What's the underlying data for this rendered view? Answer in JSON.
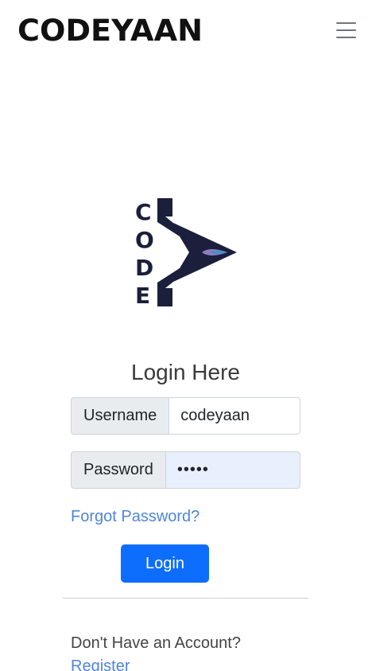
{
  "navbar": {
    "brand": "CODEYAAN",
    "menu_icon": "hamburger-menu-icon"
  },
  "logo": {
    "letters": [
      "C",
      "O",
      "D",
      "E"
    ],
    "colors": {
      "dark": "#1b1f3b",
      "accent_purple": "#8e7cc3",
      "accent_blue": "#4a90c8"
    }
  },
  "login_form": {
    "title": "Login Here",
    "username_label": "Username",
    "username_value": "codeyaan",
    "password_label": "Password",
    "password_value": "•••••",
    "forgot_password": "Forgot Password?",
    "login_button": "Login"
  },
  "signup": {
    "prompt": "Don't Have an Account?",
    "register_link": "Register"
  },
  "colors": {
    "primary": "#0d6efd",
    "link": "#4f86d6",
    "addon_bg": "#e9ecef",
    "autofill_bg": "#e8f0fe"
  }
}
